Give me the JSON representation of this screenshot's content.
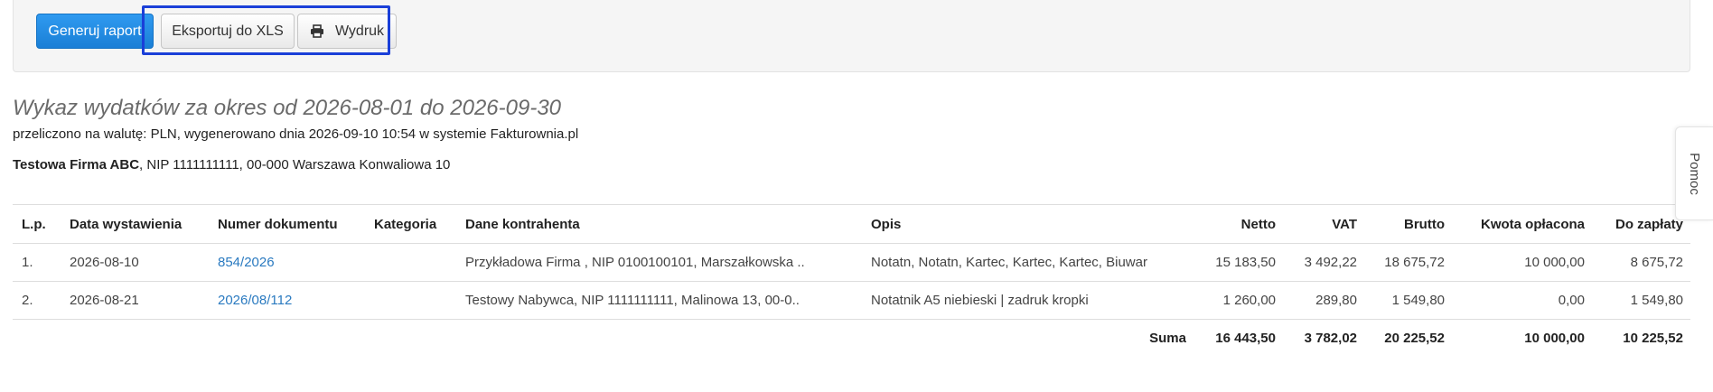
{
  "toolbar": {
    "generate_label": "Generuj raport",
    "export_xls_label": "Eksportuj do XLS",
    "print_label": "Wydruk",
    "print_icon": "printer-icon"
  },
  "report": {
    "title": "Wykaz wydatków za okres od 2026-08-01 do 2026-09-30",
    "meta": "przeliczono na walutę: PLN, wygenerowano dnia 2026-09-10 10:54 w systemie Fakturownia.pl",
    "company_name": "Testowa Firma ABC",
    "company_details": ", NIP 1111111111, 00-000 Warszawa Konwaliowa 10"
  },
  "table": {
    "headers": {
      "lp": "L.p.",
      "date": "Data wystawienia",
      "number": "Numer dokumentu",
      "category": "Kategoria",
      "contractor": "Dane kontrahenta",
      "description": "Opis",
      "netto": "Netto",
      "vat": "VAT",
      "brutto": "Brutto",
      "paid": "Kwota opłacona",
      "due": "Do zapłaty"
    },
    "rows": [
      {
        "lp": "1.",
        "date": "2026-08-10",
        "number": "854/2026",
        "category": "",
        "contractor": "Przykładowa Firma , NIP 0100100101, Marszałkowska ..",
        "description": "Notatn, Notatn, Kartec, Kartec, Kartec, Biuwar",
        "netto": "15 183,50",
        "vat": "3 492,22",
        "brutto": "18 675,72",
        "paid": "10 000,00",
        "due": "8 675,72"
      },
      {
        "lp": "2.",
        "date": "2026-08-21",
        "number": "2026/08/112",
        "category": "",
        "contractor": "Testowy Nabywca, NIP 1111111111, Malinowa 13, 00-0..",
        "description": "Notatnik A5 niebieski | zadruk kropki",
        "netto": "1 260,00",
        "vat": "289,80",
        "brutto": "1 549,80",
        "paid": "0,00",
        "due": "1 549,80"
      }
    ],
    "sum": {
      "label": "Suma",
      "netto": "16 443,50",
      "vat": "3 782,02",
      "brutto": "20 225,52",
      "paid": "10 000,00",
      "due": "10 225,52"
    }
  },
  "help_tab": {
    "label": "Pomoc"
  },
  "colors": {
    "primary": "#1a7fd6",
    "highlight_border": "#1a3fd8",
    "link": "#2a7ac0"
  }
}
